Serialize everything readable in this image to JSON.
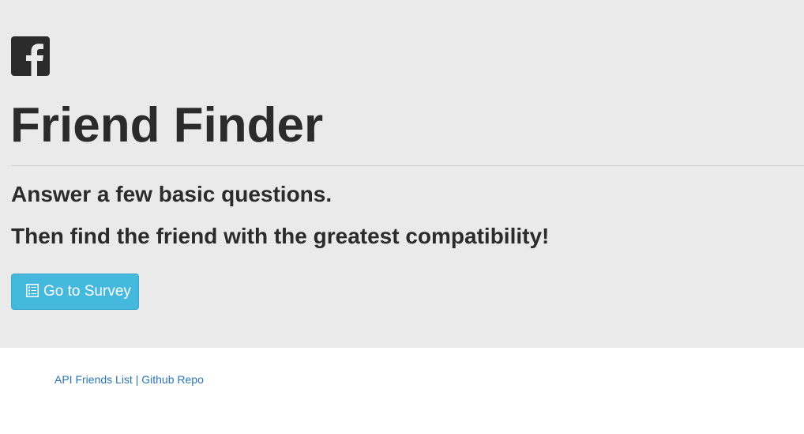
{
  "header": {
    "icon": "facebook-square-icon",
    "title": "Friend Finder",
    "line1": "Answer a few basic questions.",
    "line2": "Then find the friend with the greatest compatibility!"
  },
  "survey_button": {
    "icon": "list-alt-icon",
    "label": "Go to Survey"
  },
  "footer": {
    "api_link": "API Friends List",
    "separator": "|",
    "github_link": "Github Repo"
  },
  "colors": {
    "jumbotron_bg": "#eaeaea",
    "text": "#2b2b2b",
    "button_bg": "#45b8dd",
    "link": "#2a74b5"
  }
}
